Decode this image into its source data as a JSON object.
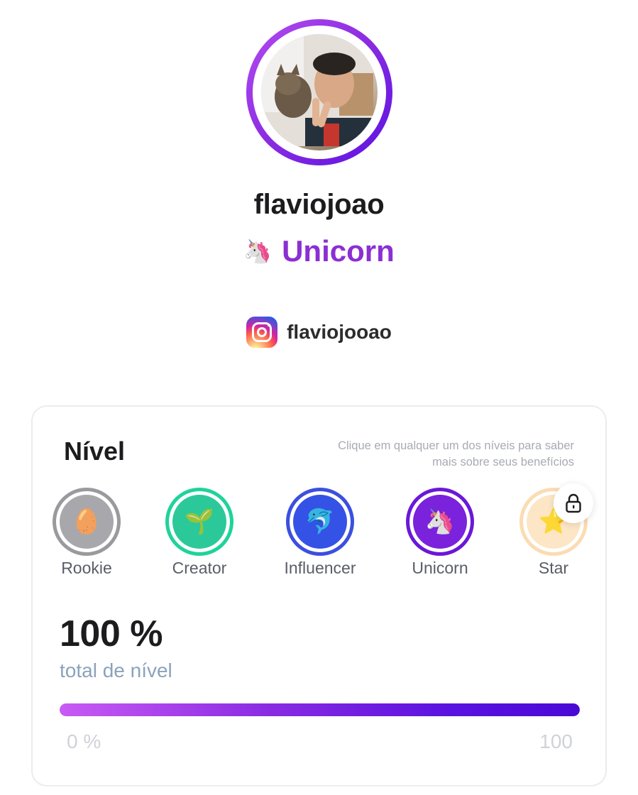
{
  "profile": {
    "username": "flaviojoao",
    "level_emoji": "🦄",
    "level_name": "Unicorn",
    "instagram_handle": "flaviojooao"
  },
  "level_card": {
    "title": "Nível",
    "hint": "Clique em qualquer um dos níveis para saber mais sobre seus benefícios",
    "levels": [
      {
        "label": "Rookie",
        "emoji": "🥚",
        "ring_color": "#9a9a9e",
        "core_color": "#a8a8ac",
        "locked": false
      },
      {
        "label": "Creator",
        "emoji": "🌱",
        "ring_color": "#1fd39a",
        "core_color": "#2bc99a",
        "locked": false
      },
      {
        "label": "Influencer",
        "emoji": "🐬",
        "ring_color": "#3b4fe0",
        "core_color": "#3452e6",
        "locked": false
      },
      {
        "label": "Unicorn",
        "emoji": "🦄",
        "ring_color": "#6a18d8",
        "core_color": "#7a22dc",
        "locked": false
      },
      {
        "label": "Star",
        "emoji": "⭐",
        "ring_color": "#fbdcb2",
        "core_color": "#fce6c6",
        "locked": true
      }
    ],
    "progress_value": "100 %",
    "progress_label": "total de nível",
    "progress_fraction": 1.0,
    "range_min": "0 %",
    "range_max": "100"
  }
}
